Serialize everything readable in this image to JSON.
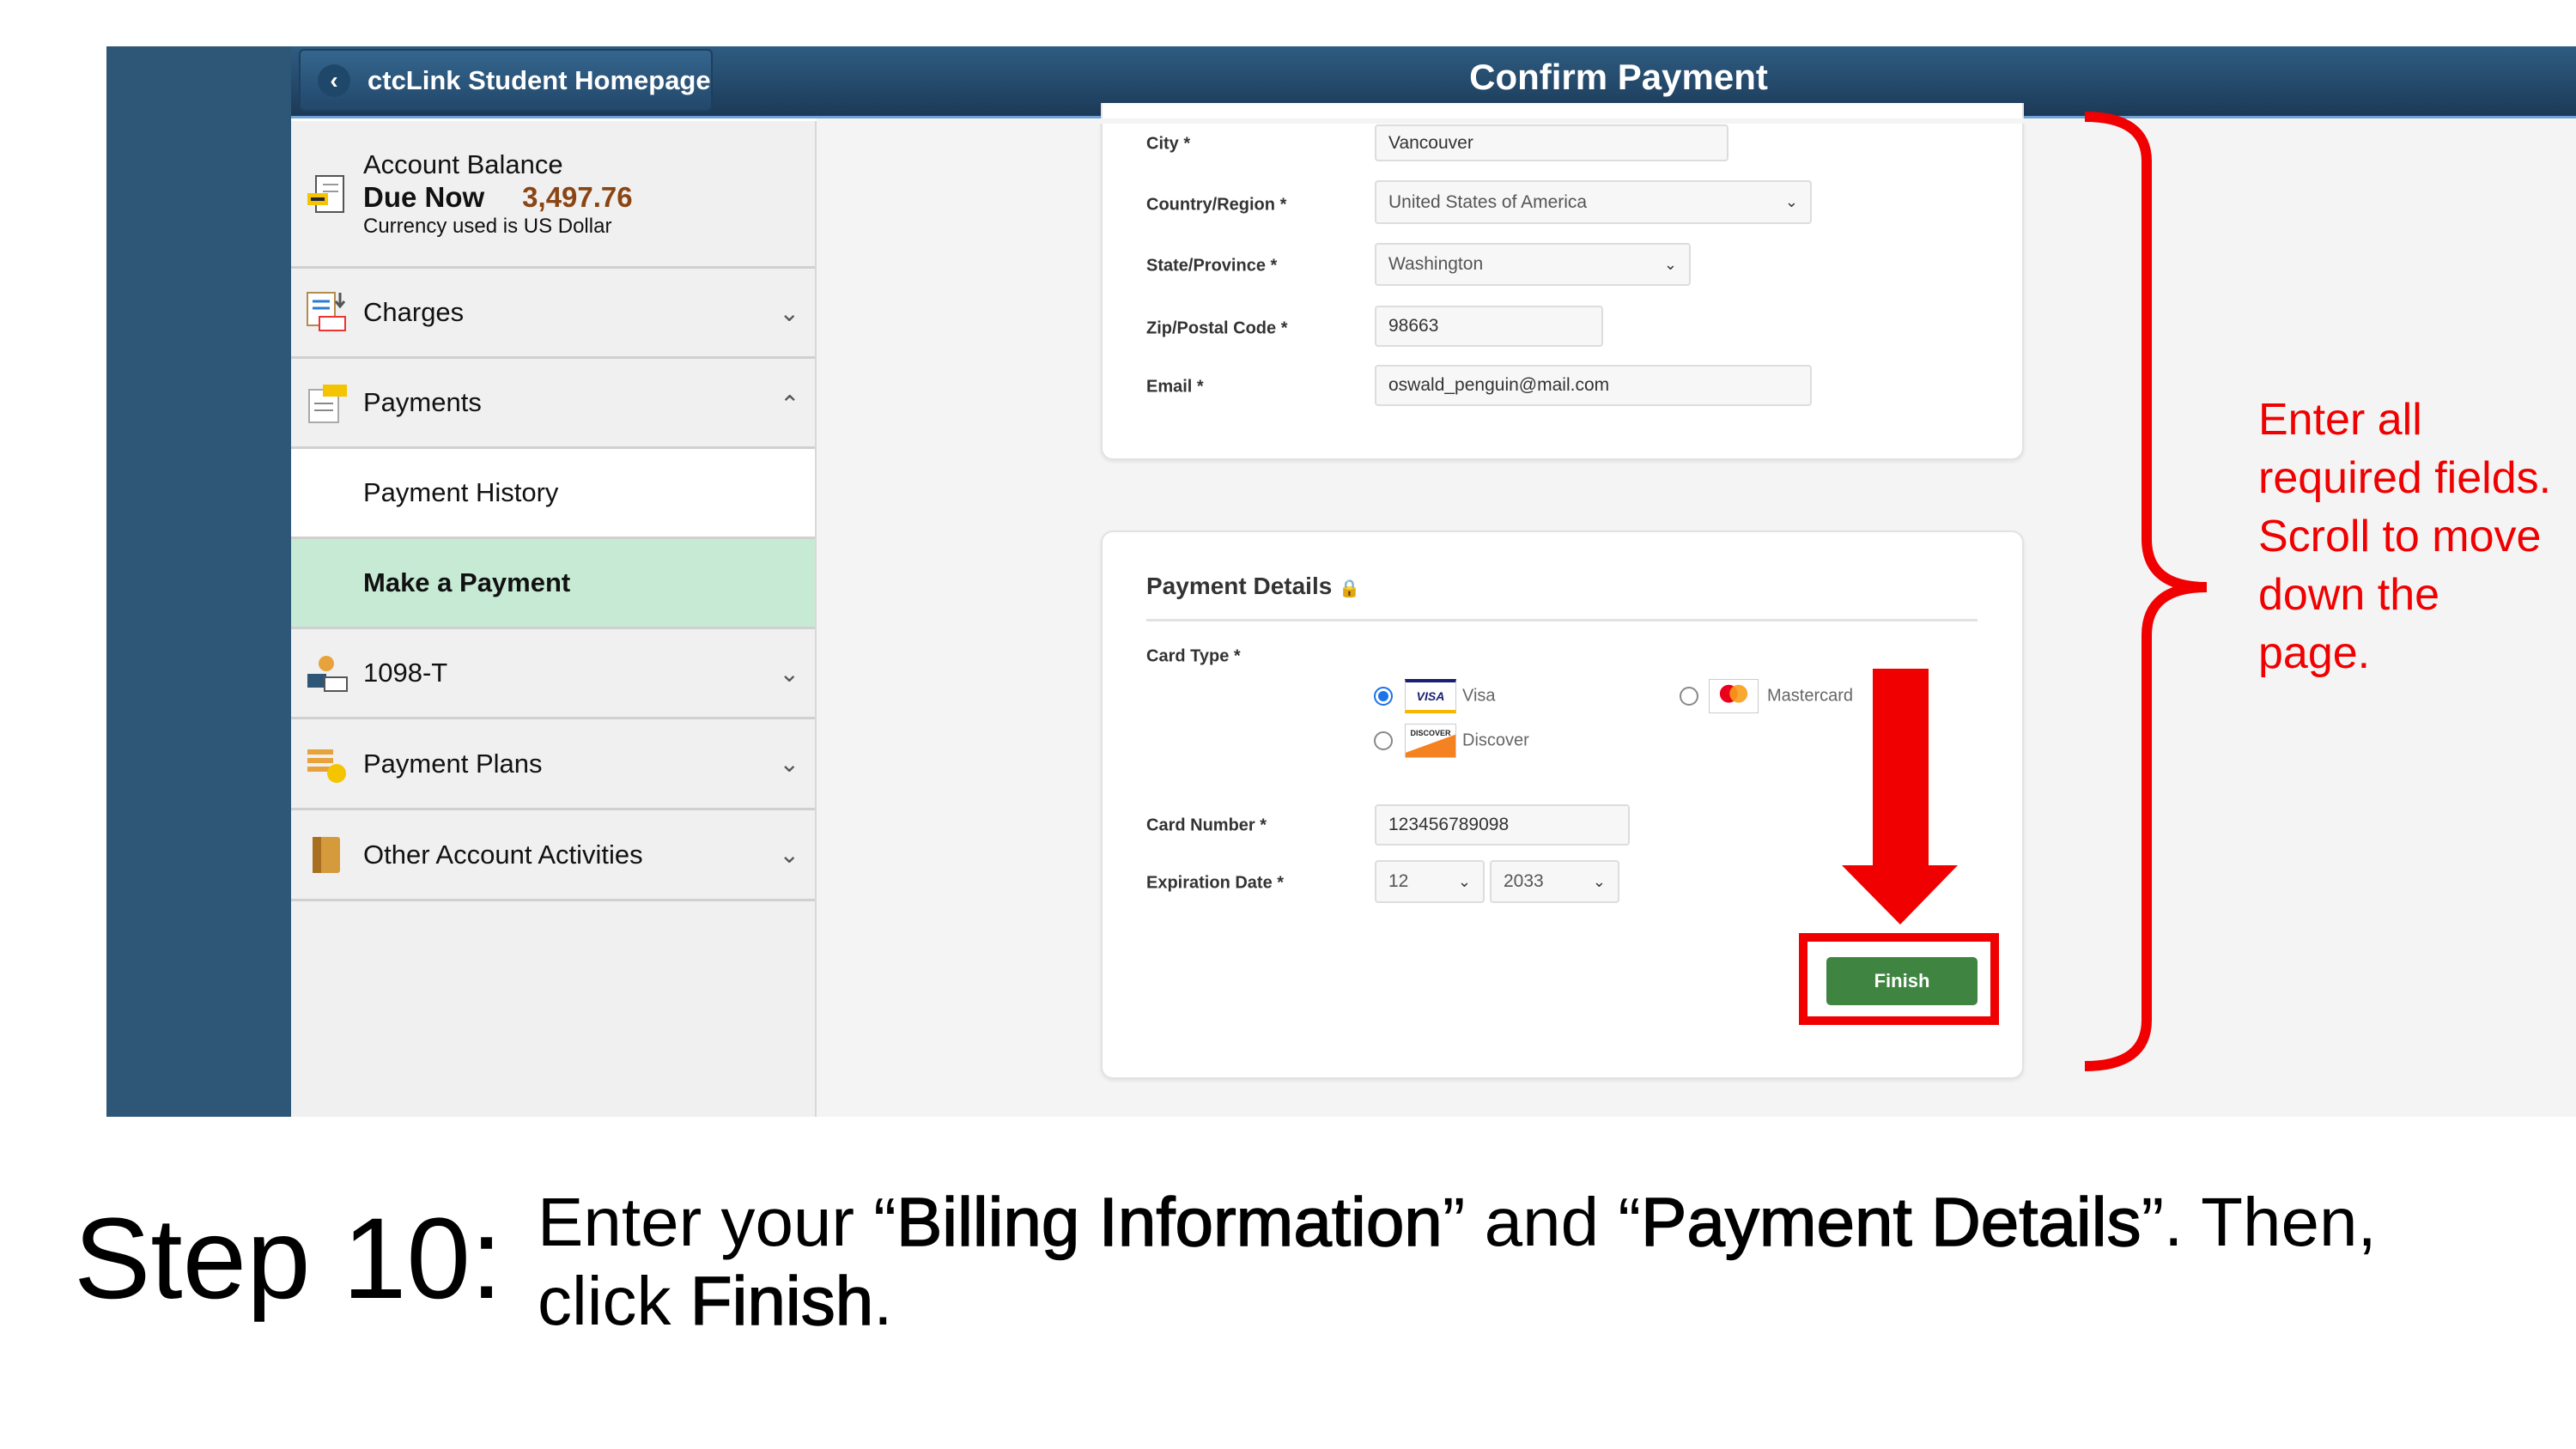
{
  "header": {
    "back_label": "ctcLink Student Homepage",
    "title": "Confirm Payment"
  },
  "sidebar": {
    "account": {
      "title": "Account Balance",
      "due_label": "Due Now",
      "due_amount": "3,497.76",
      "currency_note": "Currency used is US Dollar"
    },
    "items": [
      {
        "label": "Charges",
        "icon": "charges-icon",
        "state": "collapsed"
      },
      {
        "label": "Payments",
        "icon": "payments-icon",
        "state": "expanded"
      },
      {
        "label": "Payment History"
      },
      {
        "label": "Make a Payment",
        "selected": true
      },
      {
        "label": "1098-T",
        "icon": "tax-form-icon",
        "state": "collapsed"
      },
      {
        "label": "Payment Plans",
        "icon": "payment-plans-icon",
        "state": "collapsed"
      },
      {
        "label": "Other Account Activities",
        "icon": "other-activities-icon",
        "state": "collapsed"
      }
    ]
  },
  "billing": {
    "city": {
      "label": "City",
      "value": "Vancouver"
    },
    "country": {
      "label": "Country/Region",
      "value": "United States of America"
    },
    "state": {
      "label": "State/Province",
      "value": "Washington"
    },
    "zip": {
      "label": "Zip/Postal Code",
      "value": "98663"
    },
    "email": {
      "label": "Email",
      "value": "oswald_penguin@mail.com"
    },
    "required_mark": "*"
  },
  "payment": {
    "title": "Payment Details",
    "card_type_label": "Card Type",
    "card_types": [
      {
        "label": "Visa",
        "logo": "VISA",
        "selected": true
      },
      {
        "label": "Mastercard",
        "selected": false
      },
      {
        "label": "Discover",
        "logo": "DISCOVER",
        "selected": false
      }
    ],
    "card_number": {
      "label": "Card Number",
      "value": "123456789098"
    },
    "expiration": {
      "label": "Expiration Date",
      "month": "12",
      "year": "2033"
    },
    "finish_label": "Finish"
  },
  "annotation": {
    "text": "Enter all required fields. Scroll to move down the page.",
    "color": "#f00000"
  },
  "slide": {
    "step": "Step 10:",
    "instr_1": "Enter your “",
    "instr_2": "Billing Information",
    "instr_3": "” and “",
    "instr_4": "Payment Details",
    "instr_5": "”. Then, click ",
    "instr_6": "Finish",
    "instr_7": "."
  },
  "colors": {
    "header": "#1c3a57",
    "selected_item": "#c7ead5",
    "finish_button": "#3f8440",
    "amount": "#8b4513"
  }
}
